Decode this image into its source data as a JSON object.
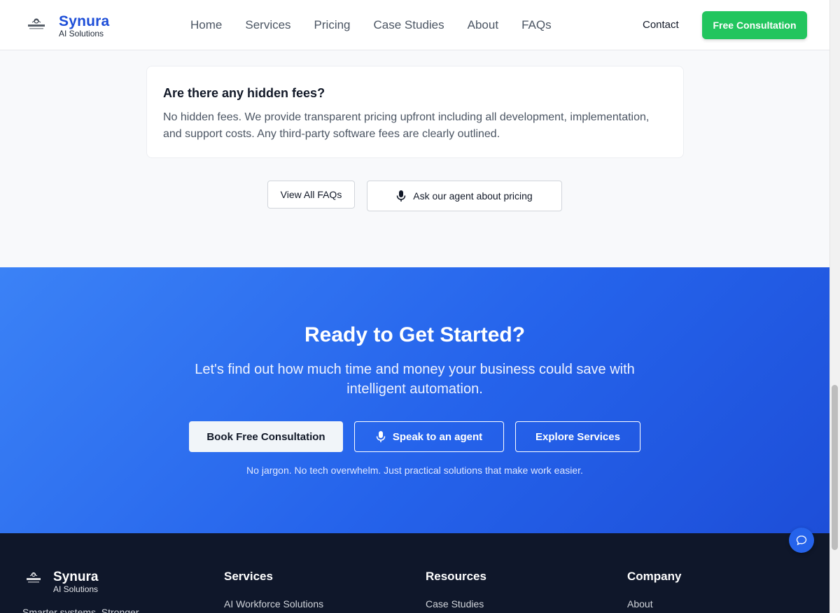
{
  "header": {
    "brand_name": "Synura",
    "brand_sub": "AI Solutions",
    "nav": [
      "Home",
      "Services",
      "Pricing",
      "Case Studies",
      "About",
      "FAQs"
    ],
    "contact_label": "Contact",
    "cta_label": "Free Consultation"
  },
  "faq": {
    "question": "Are there any hidden fees?",
    "answer": "No hidden fees. We provide transparent pricing upfront including all development, implementation, and support costs. Any third-party software fees are clearly outlined.",
    "view_all_label": "View All FAQs",
    "ask_agent_label": "Ask our agent about pricing"
  },
  "cta": {
    "title": "Ready to Get Started?",
    "subtitle": "Let's find out how much time and money your business could save with intelligent automation.",
    "book_label": "Book Free Consultation",
    "speak_label": "Speak to an agent",
    "explore_label": "Explore Services",
    "note": "No jargon. No tech overwhelm. Just practical solutions that make work easier."
  },
  "footer": {
    "brand_name": "Synura",
    "brand_sub": "AI Solutions",
    "tagline": "Smarter systems. Stronger",
    "columns": [
      {
        "title": "Services",
        "first_link": "AI Workforce Solutions"
      },
      {
        "title": "Resources",
        "first_link": "Case Studies"
      },
      {
        "title": "Company",
        "first_link": "About"
      }
    ]
  },
  "colors": {
    "brand_blue": "#1d4ed8",
    "accent_green": "#22c55e",
    "cta_gradient_start": "#3b82f6",
    "cta_gradient_end": "#1d4ed8",
    "footer_bg": "#0f172a"
  },
  "icons": {
    "microphone": "microphone-icon",
    "chat": "chat-icon",
    "logo": "logo-icon"
  }
}
